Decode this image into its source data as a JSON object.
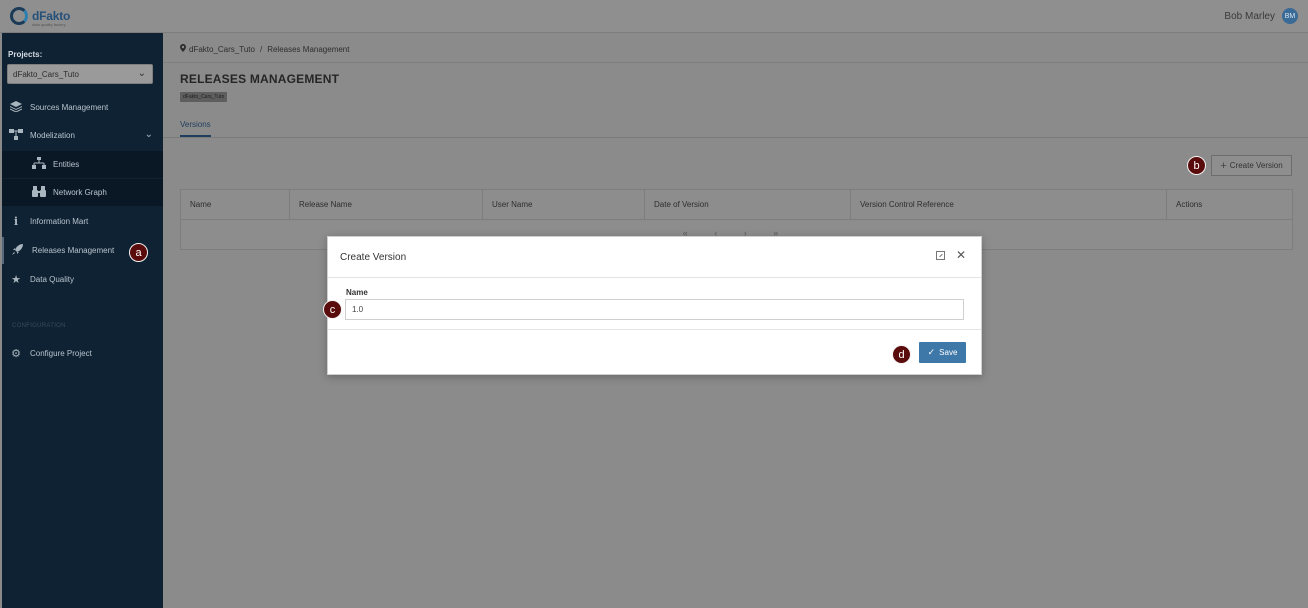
{
  "header": {
    "logo_text": "dFakto",
    "logo_tagline": "data quality factory",
    "user_name": "Bob Marley",
    "user_initials": "BM"
  },
  "sidebar": {
    "projects_label": "Projects:",
    "selected_project": "dFakto_Cars_Tuto",
    "items": [
      {
        "label": "Sources Management",
        "icon": "layers-icon"
      },
      {
        "label": "Modelization",
        "icon": "sitemap-icon"
      },
      {
        "label": "Entities",
        "icon": "entities-icon"
      },
      {
        "label": "Network Graph",
        "icon": "binoculars-icon"
      },
      {
        "label": "Information Mart",
        "icon": "info-icon"
      },
      {
        "label": "Releases Management",
        "icon": "rocket-icon"
      },
      {
        "label": "Data Quality",
        "icon": "star-icon"
      }
    ],
    "section_label": "CONFIGURATION",
    "configure_label": "Configure Project"
  },
  "breadcrumb": {
    "project": "dFakto_Cars_Tuto",
    "separator": "/",
    "current": "Releases Management"
  },
  "page": {
    "title": "RELEASES MANAGEMENT",
    "project_tag": "dFakto_Cars_Tuto",
    "tabs": [
      {
        "label": "Versions",
        "active": true
      }
    ],
    "create_button": "Create Version"
  },
  "grid": {
    "columns": [
      "Name",
      "Release Name",
      "User Name",
      "Date of Version",
      "Version Control Reference",
      "Actions"
    ],
    "pager": "« ‹ › »"
  },
  "modal": {
    "title": "Create Version",
    "field_label": "Name",
    "field_value": "1.0",
    "save_label": "Save"
  },
  "annotations": [
    "a",
    "b",
    "c",
    "d"
  ],
  "colors": {
    "sidebar_bg": "#0f2233",
    "accent": "#3d78a8",
    "badge": "#5a0c0c"
  }
}
